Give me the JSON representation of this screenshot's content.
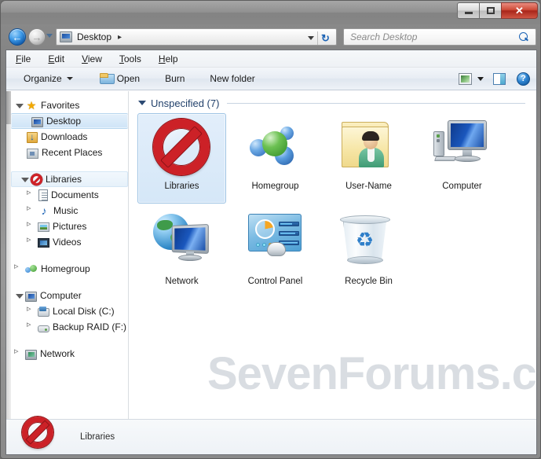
{
  "window": {
    "buttons": {
      "minimize": "–",
      "maximize": "❐",
      "close": "✕"
    }
  },
  "navbar": {
    "back_icon": "back-arrow-icon",
    "forward_icon": "forward-arrow-icon",
    "history_icon": "history-dropdown-icon",
    "breadcrumb": {
      "icon": "desktop-monitor-icon",
      "label": "Desktop",
      "separator": "▸"
    },
    "address_dropdown_icon": "chevron-down-icon",
    "refresh_label": "↻",
    "search": {
      "placeholder": "Search Desktop",
      "value": "",
      "icon": "search-icon"
    }
  },
  "menubar": {
    "items": [
      {
        "pre": "",
        "key": "F",
        "post": "ile"
      },
      {
        "pre": "",
        "key": "E",
        "post": "dit"
      },
      {
        "pre": "",
        "key": "V",
        "post": "iew"
      },
      {
        "pre": "",
        "key": "T",
        "post": "ools"
      },
      {
        "pre": "",
        "key": "H",
        "post": "elp"
      }
    ]
  },
  "commandbar": {
    "organize": "Organize",
    "open": "Open",
    "burn": "Burn",
    "new_folder": "New folder",
    "view_icon": "view-layout-icon",
    "preview_pane_icon": "preview-pane-icon",
    "help_icon": "help-icon",
    "help_glyph": "?"
  },
  "sidebar": {
    "groups": [
      {
        "header": {
          "label": "Favorites",
          "icon": "star-icon",
          "expander": "open"
        },
        "items": [
          {
            "label": "Desktop",
            "icon": "desktop-monitor-icon",
            "state": "selected",
            "expander": "none"
          },
          {
            "label": "Downloads",
            "icon": "downloads-icon",
            "state": "normal",
            "expander": "none"
          },
          {
            "label": "Recent Places",
            "icon": "recent-places-icon",
            "state": "normal",
            "expander": "none"
          }
        ]
      },
      {
        "header": {
          "label": "Libraries",
          "icon": "deny-icon",
          "expander": "open",
          "state": "hl"
        },
        "items": [
          {
            "label": "Documents",
            "icon": "document-icon",
            "state": "normal",
            "expander": "closed"
          },
          {
            "label": "Music",
            "icon": "music-note-icon",
            "state": "normal",
            "expander": "closed"
          },
          {
            "label": "Pictures",
            "icon": "pictures-icon",
            "state": "normal",
            "expander": "closed"
          },
          {
            "label": "Videos",
            "icon": "videos-icon",
            "state": "normal",
            "expander": "closed"
          }
        ]
      },
      {
        "header": {
          "label": "Homegroup",
          "icon": "homegroup-icon",
          "expander": "closed"
        },
        "items": []
      },
      {
        "header": {
          "label": "Computer",
          "icon": "computer-icon",
          "expander": "open"
        },
        "items": [
          {
            "label": "Local Disk (C:)",
            "icon": "local-disk-icon",
            "state": "normal",
            "expander": "closed"
          },
          {
            "label": "Backup RAID (F:)",
            "icon": "drive-icon",
            "state": "normal",
            "expander": "closed"
          }
        ]
      },
      {
        "header": {
          "label": "Network",
          "icon": "network-icon",
          "expander": "closed"
        },
        "items": []
      }
    ]
  },
  "content": {
    "group_header": "Unspecified (7)",
    "items": [
      {
        "label": "Libraries",
        "icon": "deny-icon",
        "selected": true
      },
      {
        "label": "Homegroup",
        "icon": "homegroup-icon",
        "selected": false
      },
      {
        "label": "User-Name",
        "icon": "user-folder-icon",
        "selected": false
      },
      {
        "label": "Computer",
        "icon": "computer-icon",
        "selected": false
      },
      {
        "label": "Network",
        "icon": "network-globe-icon",
        "selected": false
      },
      {
        "label": "Control Panel",
        "icon": "control-panel-icon",
        "selected": false
      },
      {
        "label": "Recycle Bin",
        "icon": "recycle-bin-icon",
        "selected": false
      }
    ],
    "watermark": "SevenForums.com"
  },
  "details_pane": {
    "icon": "deny-icon",
    "title": "Libraries"
  },
  "colors": {
    "accent_blue": "#1b63b5",
    "deny_red": "#cc2127",
    "group_header_blue": "#22416b",
    "selection_fill": "#d5e7f8",
    "selection_border": "#9fc4e4",
    "watermark_gray": "#d7dce1",
    "titlebar_gray": "#8d8d8d"
  }
}
